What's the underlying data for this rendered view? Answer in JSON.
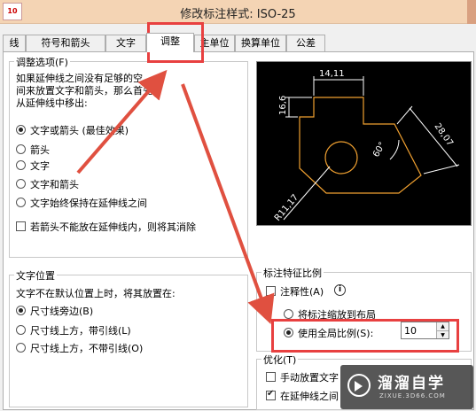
{
  "window": {
    "app_icon": "10",
    "title": "修改标注样式: ISO-25"
  },
  "tabs": [
    "线",
    "符号和箭头",
    "文字",
    "调整",
    "主单位",
    "换算单位",
    "公差"
  ],
  "fit_options": {
    "title": "调整选项(F)",
    "desc_line1": "如果延伸线之间没有足够的空",
    "desc_line2": "间来放置文字和箭头，那么首先",
    "desc_line3": "从延伸线中移出:",
    "options": [
      "文字或箭头 (最佳效果)",
      "箭头",
      "文字",
      "文字和箭头",
      "文字始终保持在延伸线之间"
    ],
    "suppress_label": "若箭头不能放在延伸线内，则将其消除"
  },
  "text_placement": {
    "title": "文字位置",
    "desc": "文字不在默认位置上时，将其放置在:",
    "options": [
      "尺寸线旁边(B)",
      "尺寸线上方，带引线(L)",
      "尺寸线上方，不带引线(O)"
    ]
  },
  "scale": {
    "title": "标注特征比例",
    "annotative_label": "注释性(A)",
    "layout_option": "将标注缩放到布局",
    "global_option": "使用全局比例(S):",
    "global_value": "10"
  },
  "finetune": {
    "title": "优化(T)",
    "manual_label": "手动放置文字",
    "draw_label": "在延伸线之间"
  },
  "preview": {
    "dim_top": "14,11",
    "dim_left": "16,6",
    "dim_right": "28,07",
    "dim_angle": "60°",
    "dim_radius": "R11,17"
  },
  "watermark": {
    "brand": "溜溜自学",
    "url": "ZIXUE.3D66.COM"
  },
  "colors": {
    "highlight": "#e84040",
    "accent_arrow": "#e05040"
  }
}
